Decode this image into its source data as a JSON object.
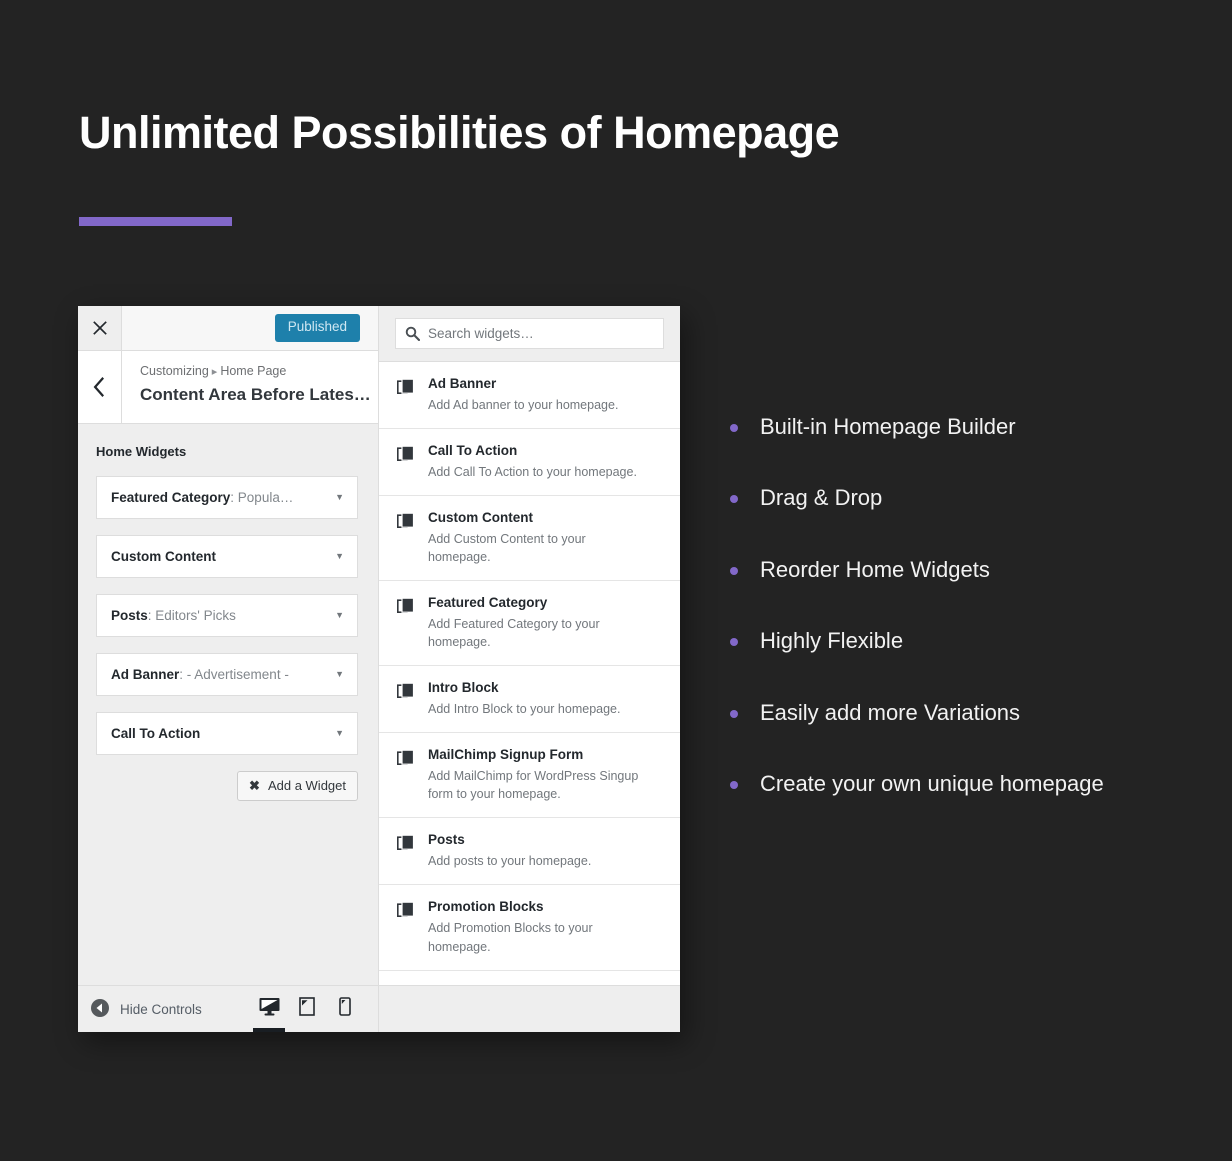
{
  "slide": {
    "title": "Unlimited Possibilities of Homepage",
    "accent_color": "#8268c9",
    "background_color": "#232323"
  },
  "customizer": {
    "close_icon": "close-icon",
    "publish_button": "Published",
    "publish_color": "#1e80ab",
    "back_icon": "chevron-left-icon",
    "breadcrumb": {
      "root": "Customizing",
      "separator": "▸",
      "current": "Home Page"
    },
    "panel_title": "Content Area Before Lates…",
    "section": {
      "title": "Home Widgets",
      "widgets": [
        {
          "name": "Featured Category",
          "value": "Popula…"
        },
        {
          "name": "Custom Content",
          "value": ""
        },
        {
          "name": "Posts",
          "value": "Editors' Picks"
        },
        {
          "name": "Ad Banner",
          "value": "- Advertisement -"
        },
        {
          "name": "Call To Action",
          "value": ""
        }
      ],
      "add_widget_label": "Add a Widget",
      "add_widget_icon": "close-x-icon"
    },
    "search": {
      "placeholder": "Search widgets…",
      "value": "",
      "icon": "search-icon"
    },
    "available_widgets": [
      {
        "title": "Ad Banner",
        "desc": "Add Ad banner to your homepage.",
        "icon": "copy-pages-icon"
      },
      {
        "title": "Call To Action",
        "desc": "Add Call To Action to your homepage.",
        "icon": "copy-pages-icon"
      },
      {
        "title": "Custom Content",
        "desc": "Add Custom Content to your homepage.",
        "icon": "copy-pages-icon"
      },
      {
        "title": "Featured Category",
        "desc": "Add Featured Category to your homepage.",
        "icon": "copy-pages-icon"
      },
      {
        "title": "Intro Block",
        "desc": "Add Intro Block to your homepage.",
        "icon": "copy-pages-icon"
      },
      {
        "title": "MailChimp Signup Form",
        "desc": "Add MailChimp for WordPress Singup form to your homepage.",
        "icon": "copy-pages-icon"
      },
      {
        "title": "Posts",
        "desc": "Add posts to your homepage.",
        "icon": "copy-pages-icon"
      },
      {
        "title": "Promotion Blocks",
        "desc": "Add Promotion Blocks to your homepage.",
        "icon": "copy-pages-icon"
      }
    ],
    "footer": {
      "hide_controls_label": "Hide Controls",
      "hide_controls_icon": "collapse-left-icon",
      "devices": [
        {
          "name": "desktop",
          "icon": "desktop-icon",
          "active": true
        },
        {
          "name": "tablet",
          "icon": "tablet-icon",
          "active": false
        },
        {
          "name": "mobile",
          "icon": "mobile-icon",
          "active": false
        }
      ]
    }
  },
  "features": [
    {
      "label": "Built-in Homepage Builder"
    },
    {
      "label": "Drag & Drop"
    },
    {
      "label": "Reorder Home Widgets"
    },
    {
      "label": "Highly Flexible"
    },
    {
      "label": "Easily add more Variations"
    },
    {
      "label": "Create your own unique homepage"
    }
  ]
}
